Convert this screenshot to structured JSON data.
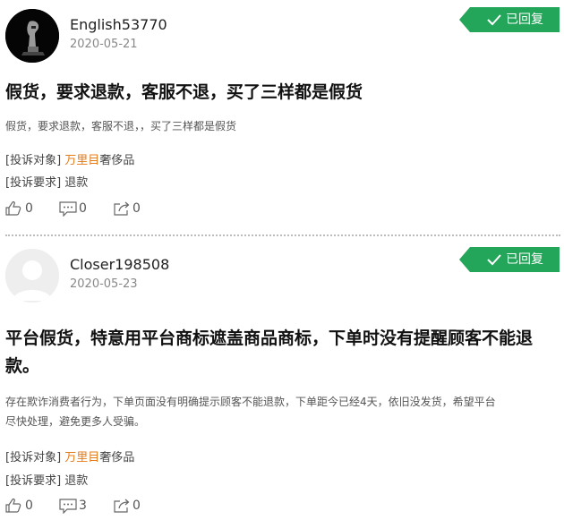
{
  "complaints": [
    {
      "username": "English53770",
      "date": "2020-05-21",
      "status": "已回复",
      "title": "假货，要求退款，客服不退，买了三样都是假货",
      "description": "假货，要求退款，客服不退，，买了三样都是假货",
      "target_label": "[投诉对象]",
      "target_value": "万里目",
      "target_suffix": "奢侈品",
      "request_label": "[投诉要求]",
      "request_value": "退款",
      "likes": "0",
      "comments": "0",
      "shares": "0"
    },
    {
      "username": "Closer198508",
      "date": "2020-05-23",
      "status": "已回复",
      "title_line1": "平台假货，特意用平台商标遮盖商品商标，下单时没有提醒顾客不能退",
      "title_line2": "款。",
      "description_line1": "存在欺诈消费者行为，下单页面没有明确提示顾客不能退款，下单距今已经4天，依旧没发货，希望平台",
      "description_line2": "尽快处理，避免更多人受骗。",
      "target_label": "[投诉对象]",
      "target_value": "万里目",
      "target_suffix": "奢侈品",
      "request_label": "[投诉要求]",
      "request_value": "退款",
      "likes": "0",
      "comments": "3",
      "shares": "0"
    }
  ],
  "colors": {
    "badge": "#23a55a",
    "target_highlight": "#e57c1b"
  }
}
